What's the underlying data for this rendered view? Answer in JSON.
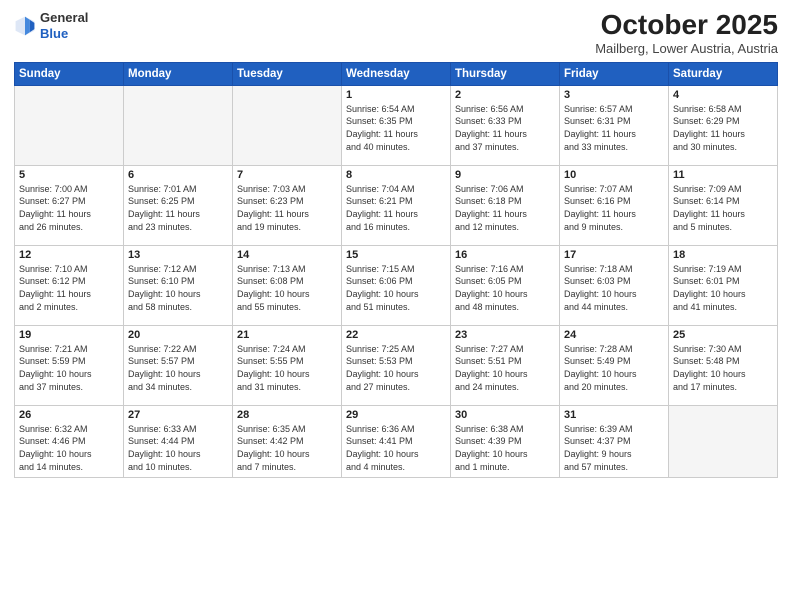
{
  "header": {
    "logo_general": "General",
    "logo_blue": "Blue",
    "month_title": "October 2025",
    "subtitle": "Mailberg, Lower Austria, Austria"
  },
  "weekdays": [
    "Sunday",
    "Monday",
    "Tuesday",
    "Wednesday",
    "Thursday",
    "Friday",
    "Saturday"
  ],
  "weeks": [
    [
      {
        "day": "",
        "info": ""
      },
      {
        "day": "",
        "info": ""
      },
      {
        "day": "",
        "info": ""
      },
      {
        "day": "1",
        "info": "Sunrise: 6:54 AM\nSunset: 6:35 PM\nDaylight: 11 hours\nand 40 minutes."
      },
      {
        "day": "2",
        "info": "Sunrise: 6:56 AM\nSunset: 6:33 PM\nDaylight: 11 hours\nand 37 minutes."
      },
      {
        "day": "3",
        "info": "Sunrise: 6:57 AM\nSunset: 6:31 PM\nDaylight: 11 hours\nand 33 minutes."
      },
      {
        "day": "4",
        "info": "Sunrise: 6:58 AM\nSunset: 6:29 PM\nDaylight: 11 hours\nand 30 minutes."
      }
    ],
    [
      {
        "day": "5",
        "info": "Sunrise: 7:00 AM\nSunset: 6:27 PM\nDaylight: 11 hours\nand 26 minutes."
      },
      {
        "day": "6",
        "info": "Sunrise: 7:01 AM\nSunset: 6:25 PM\nDaylight: 11 hours\nand 23 minutes."
      },
      {
        "day": "7",
        "info": "Sunrise: 7:03 AM\nSunset: 6:23 PM\nDaylight: 11 hours\nand 19 minutes."
      },
      {
        "day": "8",
        "info": "Sunrise: 7:04 AM\nSunset: 6:21 PM\nDaylight: 11 hours\nand 16 minutes."
      },
      {
        "day": "9",
        "info": "Sunrise: 7:06 AM\nSunset: 6:18 PM\nDaylight: 11 hours\nand 12 minutes."
      },
      {
        "day": "10",
        "info": "Sunrise: 7:07 AM\nSunset: 6:16 PM\nDaylight: 11 hours\nand 9 minutes."
      },
      {
        "day": "11",
        "info": "Sunrise: 7:09 AM\nSunset: 6:14 PM\nDaylight: 11 hours\nand 5 minutes."
      }
    ],
    [
      {
        "day": "12",
        "info": "Sunrise: 7:10 AM\nSunset: 6:12 PM\nDaylight: 11 hours\nand 2 minutes."
      },
      {
        "day": "13",
        "info": "Sunrise: 7:12 AM\nSunset: 6:10 PM\nDaylight: 10 hours\nand 58 minutes."
      },
      {
        "day": "14",
        "info": "Sunrise: 7:13 AM\nSunset: 6:08 PM\nDaylight: 10 hours\nand 55 minutes."
      },
      {
        "day": "15",
        "info": "Sunrise: 7:15 AM\nSunset: 6:06 PM\nDaylight: 10 hours\nand 51 minutes."
      },
      {
        "day": "16",
        "info": "Sunrise: 7:16 AM\nSunset: 6:05 PM\nDaylight: 10 hours\nand 48 minutes."
      },
      {
        "day": "17",
        "info": "Sunrise: 7:18 AM\nSunset: 6:03 PM\nDaylight: 10 hours\nand 44 minutes."
      },
      {
        "day": "18",
        "info": "Sunrise: 7:19 AM\nSunset: 6:01 PM\nDaylight: 10 hours\nand 41 minutes."
      }
    ],
    [
      {
        "day": "19",
        "info": "Sunrise: 7:21 AM\nSunset: 5:59 PM\nDaylight: 10 hours\nand 37 minutes."
      },
      {
        "day": "20",
        "info": "Sunrise: 7:22 AM\nSunset: 5:57 PM\nDaylight: 10 hours\nand 34 minutes."
      },
      {
        "day": "21",
        "info": "Sunrise: 7:24 AM\nSunset: 5:55 PM\nDaylight: 10 hours\nand 31 minutes."
      },
      {
        "day": "22",
        "info": "Sunrise: 7:25 AM\nSunset: 5:53 PM\nDaylight: 10 hours\nand 27 minutes."
      },
      {
        "day": "23",
        "info": "Sunrise: 7:27 AM\nSunset: 5:51 PM\nDaylight: 10 hours\nand 24 minutes."
      },
      {
        "day": "24",
        "info": "Sunrise: 7:28 AM\nSunset: 5:49 PM\nDaylight: 10 hours\nand 20 minutes."
      },
      {
        "day": "25",
        "info": "Sunrise: 7:30 AM\nSunset: 5:48 PM\nDaylight: 10 hours\nand 17 minutes."
      }
    ],
    [
      {
        "day": "26",
        "info": "Sunrise: 6:32 AM\nSunset: 4:46 PM\nDaylight: 10 hours\nand 14 minutes."
      },
      {
        "day": "27",
        "info": "Sunrise: 6:33 AM\nSunset: 4:44 PM\nDaylight: 10 hours\nand 10 minutes."
      },
      {
        "day": "28",
        "info": "Sunrise: 6:35 AM\nSunset: 4:42 PM\nDaylight: 10 hours\nand 7 minutes."
      },
      {
        "day": "29",
        "info": "Sunrise: 6:36 AM\nSunset: 4:41 PM\nDaylight: 10 hours\nand 4 minutes."
      },
      {
        "day": "30",
        "info": "Sunrise: 6:38 AM\nSunset: 4:39 PM\nDaylight: 10 hours\nand 1 minute."
      },
      {
        "day": "31",
        "info": "Sunrise: 6:39 AM\nSunset: 4:37 PM\nDaylight: 9 hours\nand 57 minutes."
      },
      {
        "day": "",
        "info": ""
      }
    ]
  ]
}
